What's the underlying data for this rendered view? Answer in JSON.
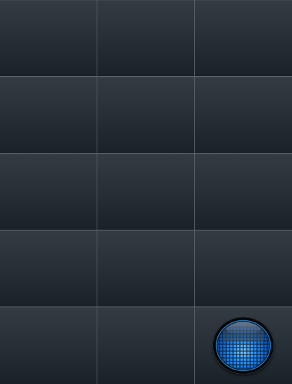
{
  "grid": {
    "rows": 5,
    "columns": 3,
    "cells": [
      {
        "id": "r1c1"
      },
      {
        "id": "r1c2"
      },
      {
        "id": "r1c3"
      },
      {
        "id": "r2c1"
      },
      {
        "id": "r2c2"
      },
      {
        "id": "r2c3"
      },
      {
        "id": "r3c1"
      },
      {
        "id": "r3c2"
      },
      {
        "id": "r3c3"
      },
      {
        "id": "r4c1"
      },
      {
        "id": "r4c2"
      },
      {
        "id": "r4c3"
      },
      {
        "id": "r5c1"
      },
      {
        "id": "r5c2"
      },
      {
        "id": "r5c3"
      }
    ]
  },
  "orb_button": {
    "icon": "grid-orb-icon",
    "accent_color": "#1e8fff",
    "glow_color": "#5fb8ff",
    "rim_color": "#050607"
  },
  "colors": {
    "cell_top": "#323c42",
    "cell_bottom": "#1a2228",
    "divider": "#5b6569"
  }
}
